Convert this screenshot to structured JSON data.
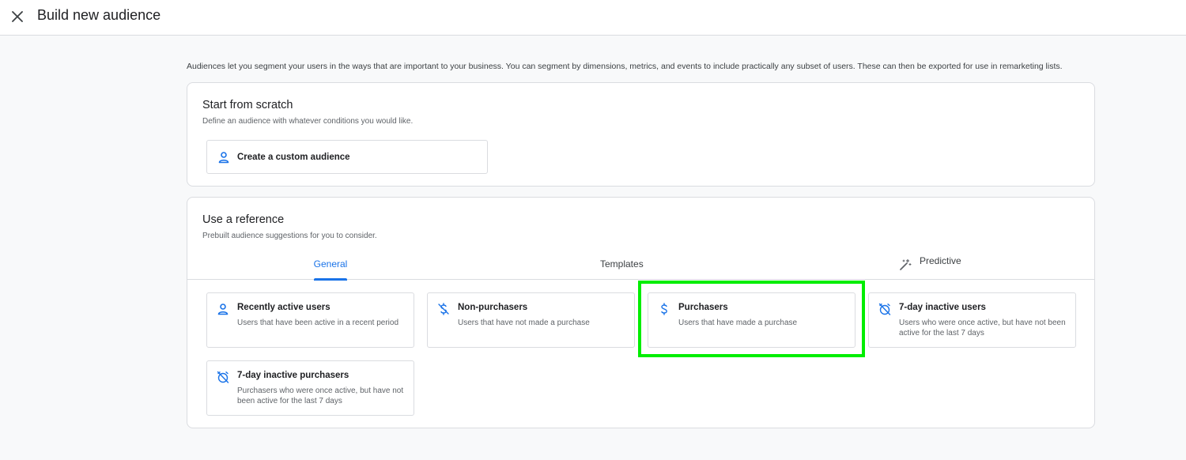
{
  "header": {
    "title": "Build new audience",
    "close_icon": "close-icon"
  },
  "intro": "Audiences let you segment your users in the ways that are important to your business. You can segment by dimensions, metrics, and events to include practically any subset of users. These can then be exported for use in remarketing lists.",
  "scratch": {
    "title": "Start from scratch",
    "subtitle": "Define an audience with whatever conditions you would like.",
    "custom_button": {
      "label": "Create a custom audience",
      "icon": "person-icon"
    }
  },
  "reference": {
    "title": "Use a reference",
    "subtitle": "Prebuilt audience suggestions for you to consider.",
    "tabs": [
      {
        "label": "General",
        "active": true
      },
      {
        "label": "Templates",
        "active": false
      },
      {
        "label": "Predictive",
        "active": false,
        "icon": "magic-wand-icon"
      }
    ],
    "items": [
      {
        "title": "Recently active users",
        "desc": "Users that have been active in a recent period",
        "icon": "person-icon"
      },
      {
        "title": "Non-purchasers",
        "desc": "Users that have not made a purchase",
        "icon": "money-off-icon"
      },
      {
        "title": "Purchasers",
        "desc": "Users that have made a purchase",
        "icon": "dollar-icon",
        "highlighted": true
      },
      {
        "title": "7-day inactive users",
        "desc": "Users who were once active, but have not been active for the last 7 days",
        "icon": "alarm-off-icon"
      },
      {
        "title": "7-day inactive purchasers",
        "desc": "Purchasers who were once active, but have not been active for the last 7 days",
        "icon": "alarm-off-icon"
      }
    ]
  },
  "colors": {
    "accent": "#1a73e8",
    "highlight": "#00ee00",
    "border": "#dadce0",
    "background": "#f8f9fa"
  }
}
